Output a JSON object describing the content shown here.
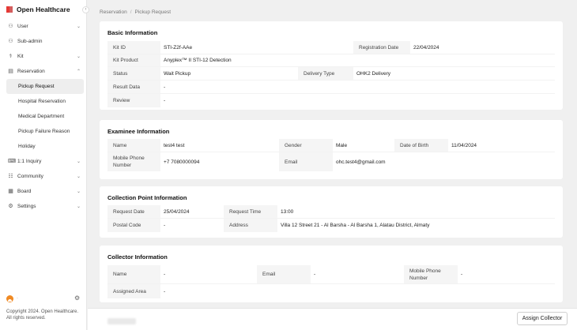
{
  "app": {
    "brand": "Open Healthcare",
    "collapse_glyph": "‹"
  },
  "sidebar": {
    "items": [
      {
        "label": "User",
        "icon": "user-icon",
        "glyph": "⚇",
        "chev": "⌄"
      },
      {
        "label": "Sub-admin",
        "icon": "person-icon",
        "glyph": "⚇",
        "chev": ""
      },
      {
        "label": "Kit",
        "icon": "kit-icon",
        "glyph": "⚕",
        "chev": "⌄"
      },
      {
        "label": "Reservation",
        "icon": "calendar-icon",
        "glyph": "▤",
        "chev": "⌃"
      },
      {
        "label": "1:1 Inquiry",
        "icon": "chat-icon",
        "glyph": "⌨",
        "chev": "⌄"
      },
      {
        "label": "Community",
        "icon": "community-icon",
        "glyph": "☷",
        "chev": "⌄"
      },
      {
        "label": "Board",
        "icon": "board-icon",
        "glyph": "▦",
        "chev": "⌄"
      },
      {
        "label": "Settings",
        "icon": "gear-icon",
        "glyph": "⚙",
        "chev": "⌄"
      }
    ],
    "reservation_sub": [
      {
        "label": "Pickup Request",
        "active": true
      },
      {
        "label": "Hospital Reservation"
      },
      {
        "label": "Medical Department"
      },
      {
        "label": "Pickup Failure Reason"
      },
      {
        "label": "Holiday"
      }
    ],
    "user_dot": "·",
    "settings_glyph": "⚙",
    "copyright_1": "Copyright 2024. Open Healthcare.",
    "copyright_2": "All rights reserved."
  },
  "breadcrumb": {
    "root": "Reservation",
    "sep": "/",
    "current": "Pickup Request"
  },
  "basic": {
    "title": "Basic Information",
    "kit_id_label": "Kit ID",
    "kit_id": "STI-Z2f-AAe",
    "reg_date_label": "Registration Date",
    "reg_date": "22/04/2024",
    "kit_product_label": "Kit Product",
    "kit_product": "Anyplex™ II STI-12 Detection",
    "status_label": "Status",
    "status": "Wait Pickup",
    "delivery_label": "Delivery Type",
    "delivery": "OHK2 Delivery",
    "result_label": "Result Data",
    "result": "-",
    "review_label": "Review",
    "review": "-"
  },
  "examinee": {
    "title": "Examinee Information",
    "name_label": "Name",
    "name": "test4 test",
    "gender_label": "Gender",
    "gender": "Male",
    "dob_label": "Date of Birth",
    "dob": "11/04/2024",
    "mobile_label_1": "Mobile Phone",
    "mobile_label_2": "Number",
    "mobile": "+7 7080000094",
    "email_label": "Email",
    "email": "ohc.test4@gmail.com"
  },
  "collection": {
    "title": "Collection Point Information",
    "req_date_label": "Request Date",
    "req_date": "25/04/2024",
    "req_time_label": "Request Time",
    "req_time": "13:00",
    "postal_label": "Postal Code",
    "postal": "-",
    "address_label": "Address",
    "address": "Villa 12 Street 21 - Al Barsha - Al Barsha 1, Alatau District, Almaty"
  },
  "collector": {
    "title": "Collector Information",
    "name_label": "Name",
    "name": "-",
    "email_label": "Email",
    "email": "-",
    "mobile_label_1": "Mobile Phone",
    "mobile_label_2": "Number",
    "mobile": "-",
    "area_label": "Assigned Area",
    "area": "-"
  },
  "actions": {
    "assign": "Assign Collector"
  }
}
